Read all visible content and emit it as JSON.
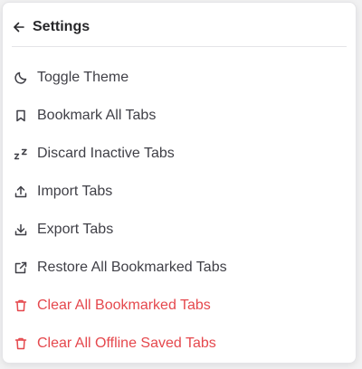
{
  "header": {
    "back_icon": "arrow-left-icon",
    "title": "Settings"
  },
  "colors": {
    "text": "#3f3f46",
    "title": "#27272a",
    "danger": "#e5484d",
    "divider": "#e4e4e7",
    "panel_bg": "#ffffff"
  },
  "menu": {
    "items": [
      {
        "label": "Toggle Theme",
        "icon": "moon-icon",
        "danger": false
      },
      {
        "label": "Bookmark All Tabs",
        "icon": "bookmark-icon",
        "danger": false
      },
      {
        "label": "Discard Inactive Tabs",
        "icon": "sleep-zz-icon",
        "danger": false
      },
      {
        "label": "Import Tabs",
        "icon": "upload-icon",
        "danger": false
      },
      {
        "label": "Export Tabs",
        "icon": "download-icon",
        "danger": false
      },
      {
        "label": "Restore All Bookmarked Tabs",
        "icon": "external-link-icon",
        "danger": false
      },
      {
        "label": "Clear All Bookmarked Tabs",
        "icon": "trash-icon",
        "danger": true
      },
      {
        "label": "Clear All Offline Saved Tabs",
        "icon": "trash-icon",
        "danger": true
      }
    ]
  }
}
